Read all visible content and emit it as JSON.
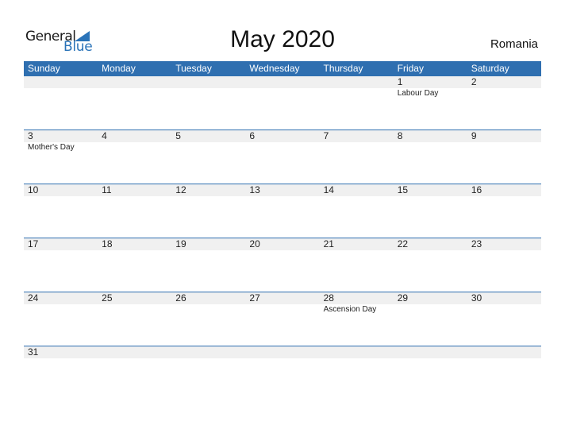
{
  "logo": {
    "general": "General",
    "blue": "Blue"
  },
  "title": "May 2020",
  "country": "Romania",
  "colors": {
    "accent": "#2f6fb0",
    "strip": "#f0f0f0"
  },
  "weekdays": [
    "Sunday",
    "Monday",
    "Tuesday",
    "Wednesday",
    "Thursday",
    "Friday",
    "Saturday"
  ],
  "weeks": [
    [
      {
        "d": ""
      },
      {
        "d": ""
      },
      {
        "d": ""
      },
      {
        "d": ""
      },
      {
        "d": ""
      },
      {
        "d": "1",
        "ev": "Labour Day"
      },
      {
        "d": "2"
      }
    ],
    [
      {
        "d": "3",
        "ev": "Mother's Day"
      },
      {
        "d": "4"
      },
      {
        "d": "5"
      },
      {
        "d": "6"
      },
      {
        "d": "7"
      },
      {
        "d": "8"
      },
      {
        "d": "9"
      }
    ],
    [
      {
        "d": "10"
      },
      {
        "d": "11"
      },
      {
        "d": "12"
      },
      {
        "d": "13"
      },
      {
        "d": "14"
      },
      {
        "d": "15"
      },
      {
        "d": "16"
      }
    ],
    [
      {
        "d": "17"
      },
      {
        "d": "18"
      },
      {
        "d": "19"
      },
      {
        "d": "20"
      },
      {
        "d": "21"
      },
      {
        "d": "22"
      },
      {
        "d": "23"
      }
    ],
    [
      {
        "d": "24"
      },
      {
        "d": "25"
      },
      {
        "d": "26"
      },
      {
        "d": "27"
      },
      {
        "d": "28",
        "ev": "Ascension Day"
      },
      {
        "d": "29"
      },
      {
        "d": "30"
      }
    ],
    [
      {
        "d": "31"
      },
      {
        "d": ""
      },
      {
        "d": ""
      },
      {
        "d": ""
      },
      {
        "d": ""
      },
      {
        "d": ""
      },
      {
        "d": ""
      }
    ]
  ]
}
